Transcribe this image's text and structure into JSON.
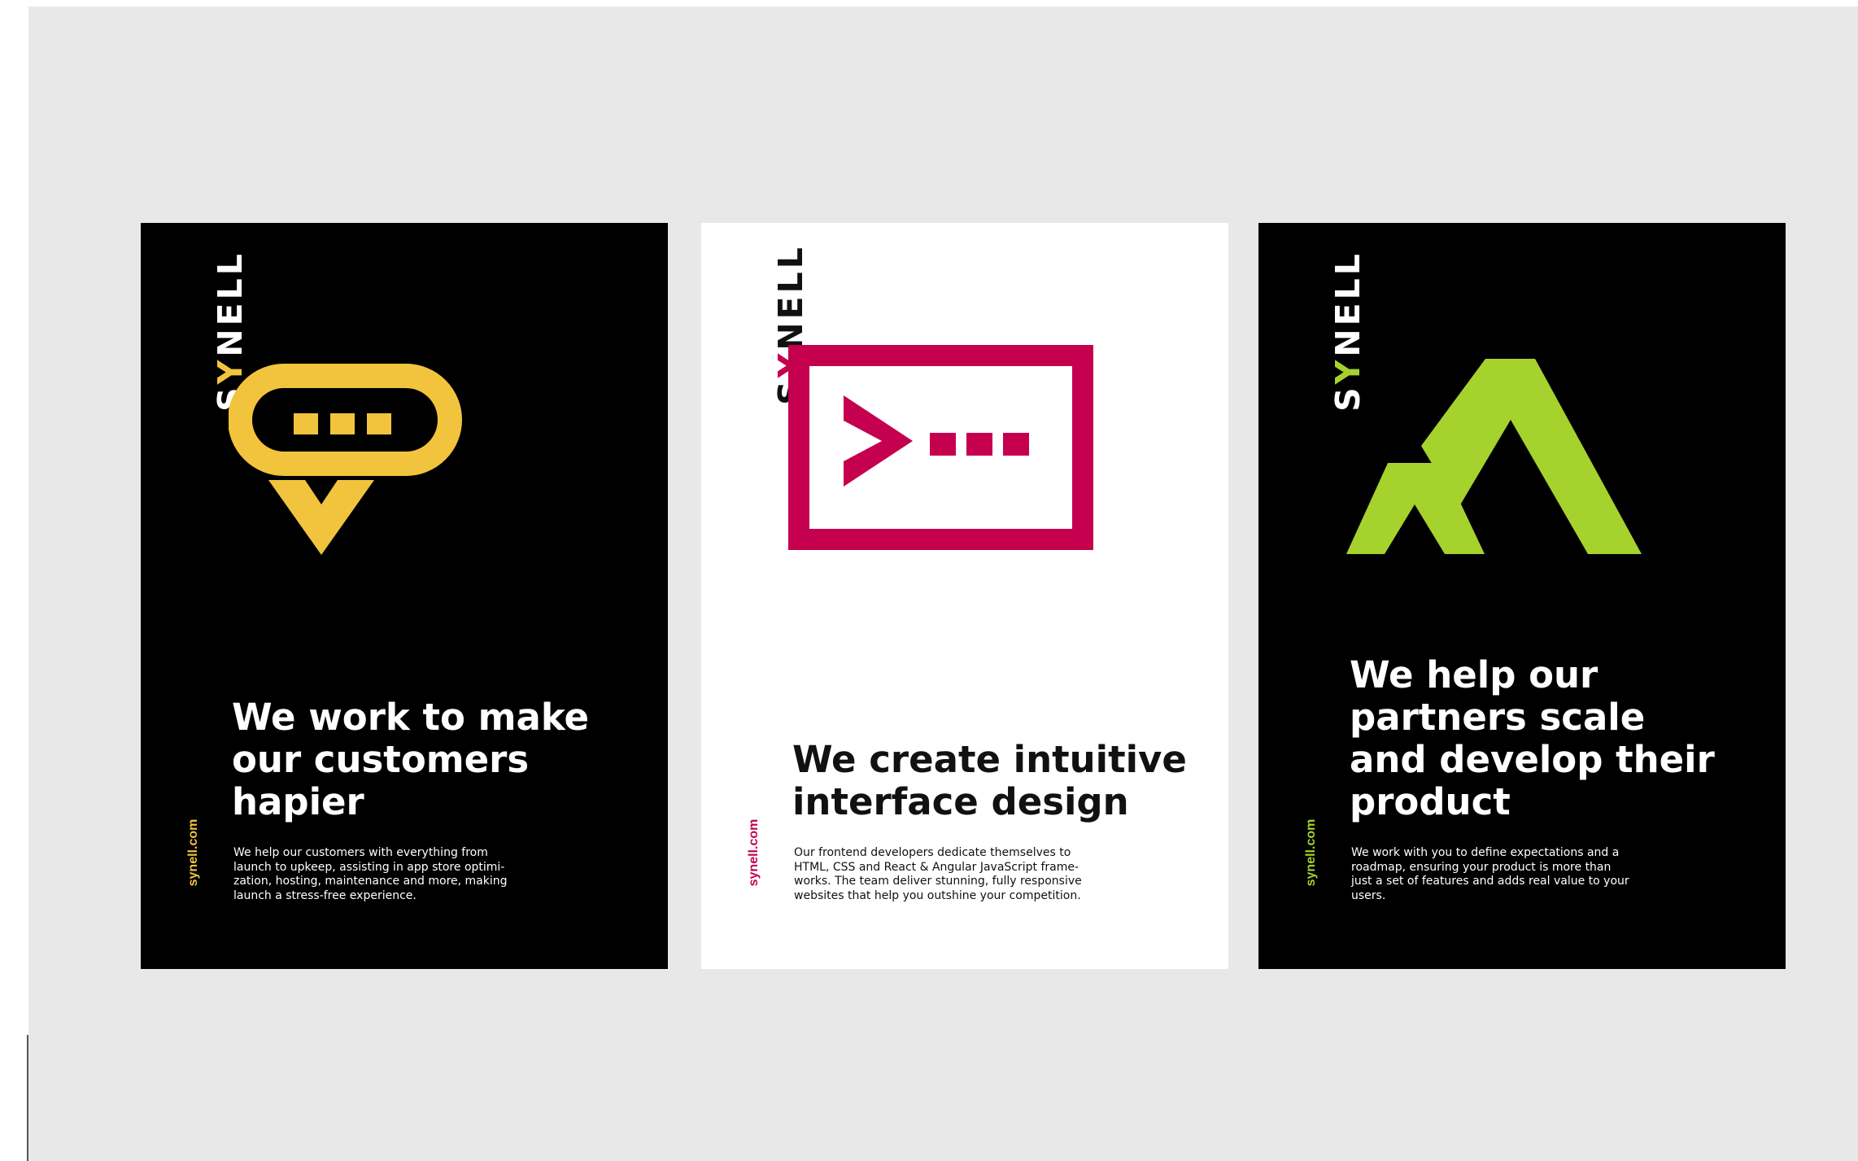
{
  "colors": {
    "canvas": "#e8e8e8",
    "dark_poster": "#000000",
    "light_poster": "#ffffff",
    "yellow": "#f2c43d",
    "magenta": "#c4004f",
    "green": "#a6d22e"
  },
  "posters": [
    {
      "theme": "dark",
      "accent": "#f2c43d",
      "icon": "chat-bubble-icon",
      "brand": {
        "pre": "S",
        "mark": "Y",
        "post": "NELL"
      },
      "headline": "We work to make\nour customers\nhapier",
      "body": "We help our customers with everything from\nlaunch to upkeep, assisting in app store optimi-\nzation, hosting, maintenance and more, making\nlaunch a stress-free experience.",
      "site": "synell.com"
    },
    {
      "theme": "light",
      "accent": "#c4004f",
      "icon": "terminal-window-icon",
      "brand": {
        "pre": "S",
        "mark": "Y",
        "post": "NELL"
      },
      "headline": "We create intuitive\ninterface design",
      "body": "Our frontend developers dedicate themselves to\nHTML, CSS and React & Angular JavaScript frame-\nworks. The team deliver stunning, fully responsive\nwebsites that help you outshine your competition.",
      "site": "synell.com"
    },
    {
      "theme": "dark",
      "accent": "#a6d22e",
      "icon": "mountains-icon",
      "brand": {
        "pre": "S",
        "mark": "Y",
        "post": "NELL"
      },
      "headline": "We help our\npartners scale\nand develop their\nproduct",
      "body": "We work with you to define expectations and a\nroadmap, ensuring your product is more than\njust a set of features and adds real value to your\nusers.",
      "site": "synell.com"
    }
  ]
}
